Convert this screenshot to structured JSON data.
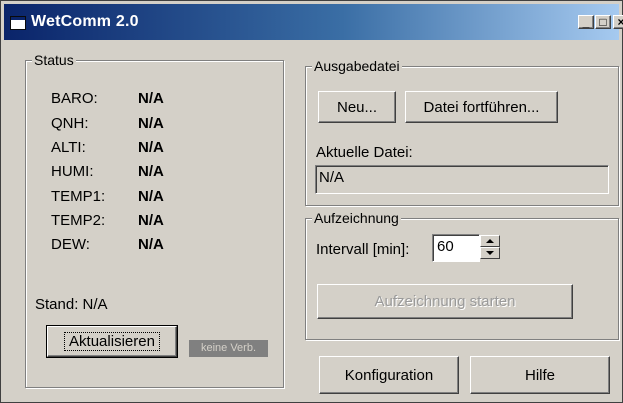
{
  "window": {
    "title": "WetComm 2.0"
  },
  "status": {
    "title": "Status",
    "rows": [
      {
        "label": "BARO:",
        "value": "N/A"
      },
      {
        "label": "QNH:",
        "value": "N/A"
      },
      {
        "label": "ALTI:",
        "value": "N/A"
      },
      {
        "label": "HUMI:",
        "value": "N/A"
      },
      {
        "label": "TEMP1:",
        "value": "N/A"
      },
      {
        "label": "TEMP2:",
        "value": "N/A"
      },
      {
        "label": "DEW:",
        "value": "N/A"
      }
    ],
    "stand": "Stand: N/A",
    "refresh_label": "Aktualisieren",
    "connection_badge": "keine Verb."
  },
  "output": {
    "title": "Ausgabedatei",
    "new_label": "Neu...",
    "continue_label": "Datei fortführen...",
    "current_file_label": "Aktuelle Datei:",
    "current_file_value": "N/A"
  },
  "recording": {
    "title": "Aufzeichnung",
    "interval_label": "Intervall [min]:",
    "interval_value": "60",
    "start_label": "Aufzeichnung starten"
  },
  "footer": {
    "config_label": "Konfiguration",
    "help_label": "Hilfe"
  }
}
